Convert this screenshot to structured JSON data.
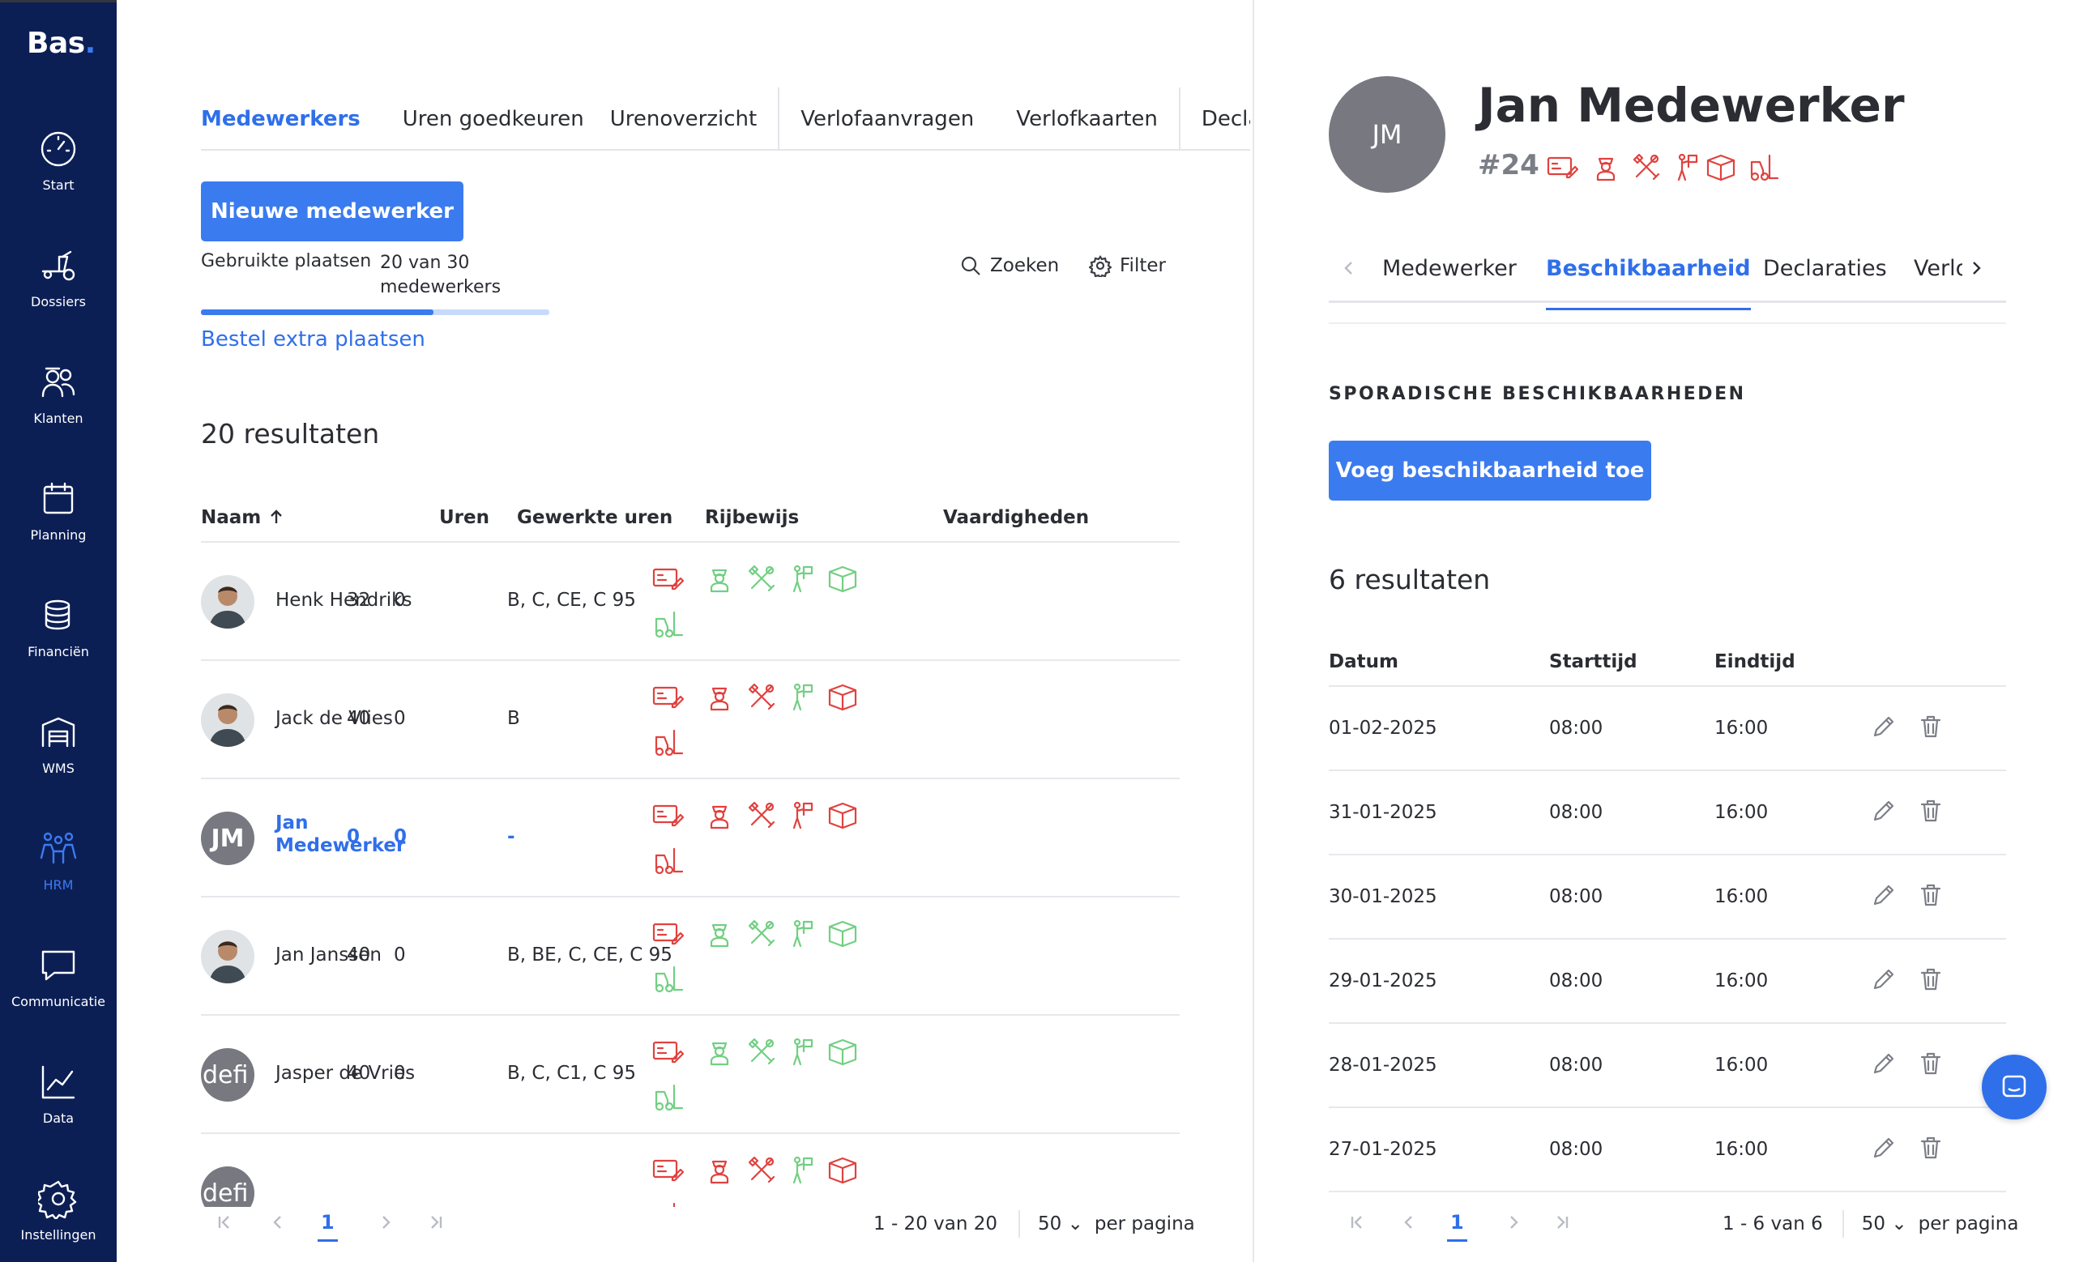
{
  "app": {
    "logo_text": "Bas",
    "logo_dot": "."
  },
  "sidebar": {
    "items": [
      {
        "label": "Start",
        "icon": "speedometer-icon"
      },
      {
        "label": "Dossiers",
        "icon": "truck-icon"
      },
      {
        "label": "Klanten",
        "icon": "customers-icon"
      },
      {
        "label": "Planning",
        "icon": "calendar-icon"
      },
      {
        "label": "Financiën",
        "icon": "coins-icon"
      },
      {
        "label": "WMS",
        "icon": "warehouse-icon"
      },
      {
        "label": "HRM",
        "icon": "team-icon",
        "active": true
      },
      {
        "label": "Communicatie",
        "icon": "chat-bubble-icon"
      },
      {
        "label": "Data",
        "icon": "chart-icon"
      },
      {
        "label": "Instellingen",
        "icon": "gear-icon"
      }
    ]
  },
  "tabs": [
    {
      "label": "Medewerkers",
      "active": true
    },
    {
      "label": "Uren goedkeuren"
    },
    {
      "label": "Urenoverzicht"
    },
    {
      "label": "Verlofaanvragen"
    },
    {
      "label": "Verlofkaarten"
    },
    {
      "label": "Declaraties"
    }
  ],
  "actions": {
    "new_employee": "Nieuwe medewerker",
    "usage_label": "Gebruikte plaatsen",
    "usage_value": "20 van 30 medewerkers",
    "usage_used": 20,
    "usage_total": 30,
    "order_more": "Bestel extra plaatsen",
    "search": "Zoeken",
    "filter": "Filter"
  },
  "list": {
    "results": "20 resultaten",
    "columns": {
      "name": "Naam",
      "hours": "Uren",
      "worked": "Gewerkte uren",
      "license": "Rijbewijs",
      "skills": "Vaardigheden"
    },
    "rows": [
      {
        "name": "Henk Hendriks",
        "hours": "32",
        "worked": "0",
        "license": "B, C, CE, C 95",
        "avatar": "photo",
        "skills_color": [
          "red",
          "green",
          "green",
          "green",
          "green",
          "green"
        ]
      },
      {
        "name": "Jack de Vlies",
        "hours": "40",
        "worked": "0",
        "license": "B",
        "avatar": "photo",
        "skills_color": [
          "red",
          "red",
          "red",
          "green",
          "red",
          "red"
        ]
      },
      {
        "name": "Jan Medewerker",
        "initials": "JM",
        "hours": "0",
        "worked": "0",
        "license": "-",
        "selected": true,
        "avatar": "initials",
        "skills_color": [
          "red",
          "red",
          "red",
          "red",
          "red",
          "red"
        ]
      },
      {
        "name": "Jan Janssen",
        "hours": "40",
        "worked": "0",
        "license": "B, BE, C, CE, C 95",
        "avatar": "photo",
        "skills_color": [
          "red",
          "green",
          "green",
          "green",
          "green",
          "green"
        ]
      },
      {
        "name": "Jasper de Vries",
        "initials": "defi",
        "hours": "40",
        "worked": "0",
        "license": "B, C, C1, C 95",
        "avatar": "initials",
        "skills_color": [
          "red",
          "green",
          "green",
          "green",
          "green",
          "green"
        ]
      },
      {
        "name": "",
        "initials": "defi",
        "hours": "",
        "worked": "",
        "license": "",
        "avatar": "initials",
        "skills_color": [
          "red",
          "red",
          "red",
          "green",
          "red",
          "red"
        ]
      }
    ],
    "pager": {
      "current": "1",
      "range": "1 - 20 van 20",
      "per_page_value": "50",
      "per_page_label": "per pagina"
    }
  },
  "detail": {
    "initials": "JM",
    "name": "Jan Medewerker",
    "id": "#24",
    "tabs": [
      {
        "label": "Medewerker"
      },
      {
        "label": "Beschikbaarheid",
        "active": true
      },
      {
        "label": "Declaraties"
      },
      {
        "label": "Verlo"
      }
    ],
    "section_title": "SPORADISCHE BESCHIKBAARHEDEN",
    "add_button": "Voeg beschikbaarheid toe",
    "results": "6 resultaten",
    "columns": {
      "date": "Datum",
      "start": "Starttijd",
      "end": "Eindtijd"
    },
    "rows": [
      {
        "date": "01-02-2025",
        "start": "08:00",
        "end": "16:00"
      },
      {
        "date": "31-01-2025",
        "start": "08:00",
        "end": "16:00"
      },
      {
        "date": "30-01-2025",
        "start": "08:00",
        "end": "16:00"
      },
      {
        "date": "29-01-2025",
        "start": "08:00",
        "end": "16:00"
      },
      {
        "date": "28-01-2025",
        "start": "08:00",
        "end": "16:00"
      },
      {
        "date": "27-01-2025",
        "start": "08:00",
        "end": "16:00"
      }
    ],
    "pager": {
      "current": "1",
      "range": "1 - 6 van 6",
      "per_page_value": "50",
      "per_page_label": "per pagina"
    }
  },
  "colors": {
    "brand": "#0c1f55",
    "accent": "#3b7bf0",
    "skill_red": "#e0423f",
    "skill_green": "#72cf83"
  }
}
